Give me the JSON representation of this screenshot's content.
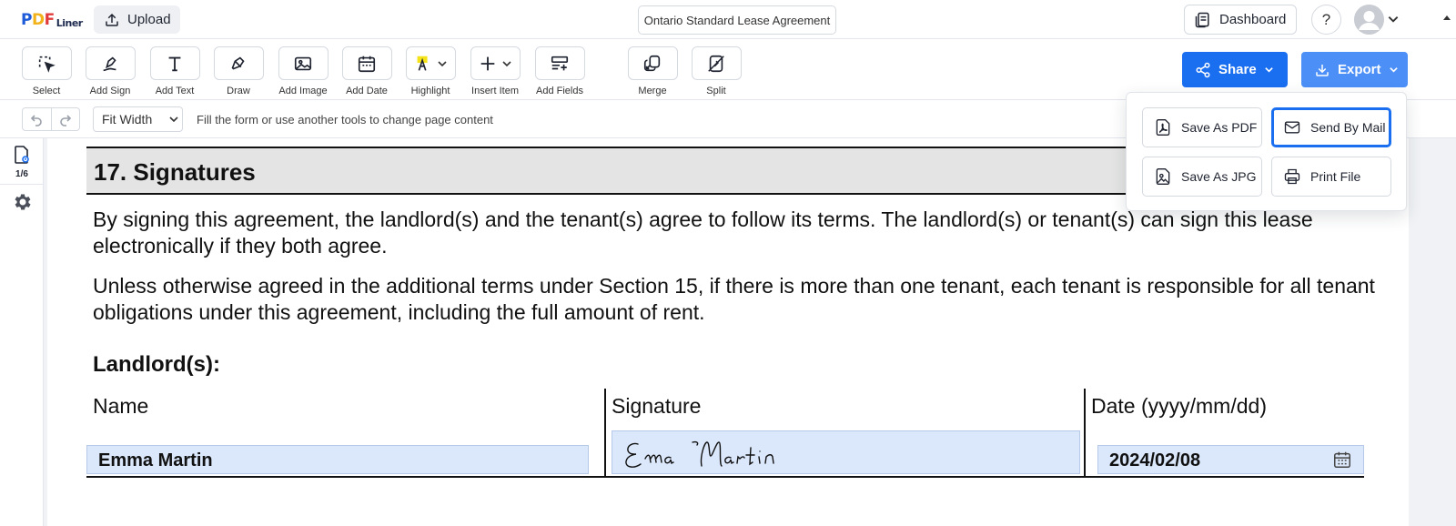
{
  "header": {
    "logo_main_p": "P",
    "logo_main_d": "D",
    "logo_main_f": "F",
    "logo_sub": "Liner",
    "upload_label": "Upload",
    "document_title": "Ontario Standard Lease Agreement",
    "dashboard_label": "Dashboard",
    "help_label": "?"
  },
  "toolbar": {
    "tools": [
      {
        "label": "Select",
        "icon": "select-icon"
      },
      {
        "label": "Add Sign",
        "icon": "sign-icon"
      },
      {
        "label": "Add Text",
        "icon": "text-icon"
      },
      {
        "label": "Draw",
        "icon": "draw-icon"
      },
      {
        "label": "Add Image",
        "icon": "image-icon"
      },
      {
        "label": "Add Date",
        "icon": "calendar-icon"
      },
      {
        "label": "Highlight",
        "icon": "highlight-icon"
      },
      {
        "label": "Insert Item",
        "icon": "plus-icon"
      },
      {
        "label": "Add Fields",
        "icon": "fields-icon"
      },
      {
        "label": "Merge",
        "icon": "merge-icon"
      },
      {
        "label": "Split",
        "icon": "split-icon"
      }
    ],
    "share_label": "Share",
    "export_label": "Export",
    "accent": "#1a6ef0",
    "export_color": "#4b8ff7"
  },
  "subbar": {
    "zoom_value": "Fit Width",
    "hint": "Fill the form or use another tools to change page content"
  },
  "leftrail": {
    "page_indicator": "1/6"
  },
  "export_menu": {
    "items": [
      {
        "label": "Save As PDF",
        "icon": "pdf-icon"
      },
      {
        "label": "Send By Mail",
        "icon": "mail-icon",
        "selected": true
      },
      {
        "label": "Save As JPG",
        "icon": "jpg-icon"
      },
      {
        "label": "Print File",
        "icon": "printer-icon"
      }
    ]
  },
  "document": {
    "section_title": "17. Signatures",
    "paragraph1": "By signing this agreement, the landlord(s) and the tenant(s) agree to follow its terms. The landlord(s) or tenant(s) can sign this lease electronically if they both agree.",
    "paragraph2": "Unless otherwise agreed in the additional terms under Section 15, if there is more than one tenant, each tenant is responsible for all tenant obligations under this agreement, including the full amount of rent.",
    "landlord_heading": "Landlord(s):",
    "col_name": "Name",
    "col_signature": "Signature",
    "col_date": "Date (yyyy/mm/dd)",
    "name_value": "Emma Martin",
    "signature_value": "Emma Martin",
    "date_value": "2024/02/08",
    "field_fill": "#dbe8fb"
  }
}
